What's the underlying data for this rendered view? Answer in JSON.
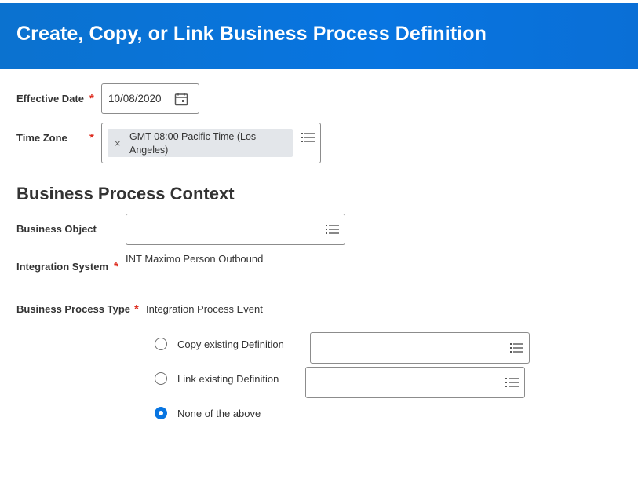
{
  "header": {
    "title": "Create, Copy, or Link Business Process Definition"
  },
  "effective_date": {
    "label": "Effective Date",
    "required": "*",
    "value": "10/08/2020"
  },
  "time_zone": {
    "label": "Time Zone",
    "required": "*",
    "selected_line1": "GMT-08:00 Pacific Time (Los",
    "selected_line2": "Angeles)",
    "remove_glyph": "×"
  },
  "section": {
    "title": "Business Process Context"
  },
  "business_object": {
    "label": "Business Object",
    "value": ""
  },
  "integration_system": {
    "label": "Integration System",
    "required": "*",
    "value": "INT Maximo Person Outbound"
  },
  "bp_type": {
    "label": "Business Process Type",
    "required": "*",
    "value": "Integration Process Event"
  },
  "options": [
    {
      "label": "Copy existing Definition",
      "checked": false
    },
    {
      "label": "Link existing Definition",
      "checked": false
    },
    {
      "label": "None of the above",
      "checked": true
    }
  ],
  "colors": {
    "accent": "#0875e1",
    "required": "#de2e21",
    "header_bg": "#0875e1"
  },
  "icons": {
    "calendar": "calendar-icon",
    "prompt": "prompt-list-icon"
  }
}
